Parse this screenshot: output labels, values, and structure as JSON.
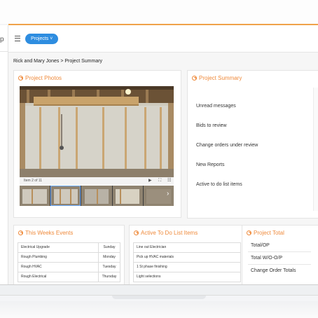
{
  "sidebar": {
    "letter": "p"
  },
  "header": {
    "projects_label": "Projects ˅"
  },
  "breadcrumb": {
    "client": "Rick and Mary Jones",
    "separator": ">",
    "current": "Project Summary"
  },
  "photos": {
    "title": "Project Photos",
    "counter": "Item 2 of 11",
    "controls": {
      "play": "▶",
      "fullscreen": "⛶",
      "grid": "☷"
    },
    "next": "›"
  },
  "summary": {
    "title": "Project Summary",
    "items": [
      "Unread messages",
      "Bids to review",
      "Change orders under review",
      "New Reports",
      "Active to do list items"
    ]
  },
  "events": {
    "title": "This Weeks Events",
    "rows": [
      {
        "name": "Electrical Upgrade",
        "day": "Sunday"
      },
      {
        "name": "Rough Plumbing",
        "day": "Monday"
      },
      {
        "name": "Rough HVAC",
        "day": "Tuesday"
      },
      {
        "name": "Rough Electrical",
        "day": "Thursday"
      }
    ]
  },
  "todo": {
    "title": "Active To Do List Items",
    "items": [
      "Line out Electrician",
      "Pick up HVAC materials",
      "1 St phase finishing",
      "Light selections"
    ]
  },
  "totals": {
    "title": "Project Total",
    "items": [
      "Total/OP",
      "Total W/O-O/P",
      "Change Order Totals"
    ]
  },
  "colors": {
    "accent": "#ef8a3b",
    "primary": "#2e8de0",
    "top_line": "#f0a24a"
  }
}
